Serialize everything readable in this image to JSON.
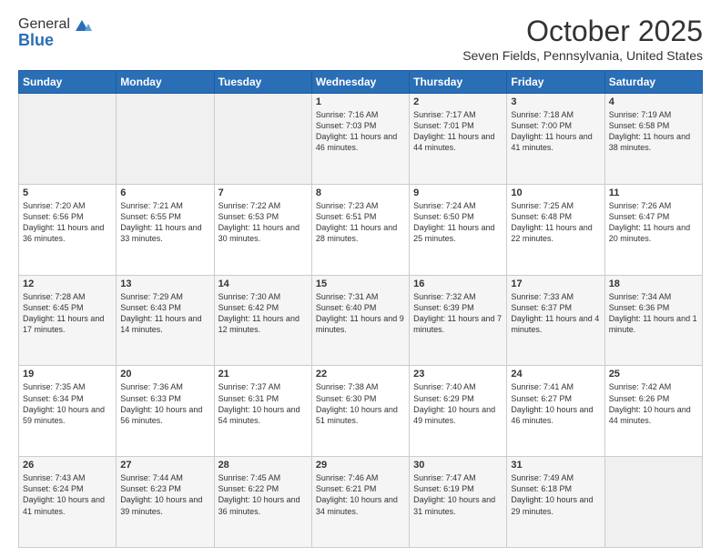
{
  "logo": {
    "general": "General",
    "blue": "Blue"
  },
  "header": {
    "title": "October 2025",
    "subtitle": "Seven Fields, Pennsylvania, United States"
  },
  "weekdays": [
    "Sunday",
    "Monday",
    "Tuesday",
    "Wednesday",
    "Thursday",
    "Friday",
    "Saturday"
  ],
  "weeks": [
    [
      {
        "day": "",
        "content": ""
      },
      {
        "day": "",
        "content": ""
      },
      {
        "day": "",
        "content": ""
      },
      {
        "day": "1",
        "content": "Sunrise: 7:16 AM\nSunset: 7:03 PM\nDaylight: 11 hours and 46 minutes."
      },
      {
        "day": "2",
        "content": "Sunrise: 7:17 AM\nSunset: 7:01 PM\nDaylight: 11 hours and 44 minutes."
      },
      {
        "day": "3",
        "content": "Sunrise: 7:18 AM\nSunset: 7:00 PM\nDaylight: 11 hours and 41 minutes."
      },
      {
        "day": "4",
        "content": "Sunrise: 7:19 AM\nSunset: 6:58 PM\nDaylight: 11 hours and 38 minutes."
      }
    ],
    [
      {
        "day": "5",
        "content": "Sunrise: 7:20 AM\nSunset: 6:56 PM\nDaylight: 11 hours and 36 minutes."
      },
      {
        "day": "6",
        "content": "Sunrise: 7:21 AM\nSunset: 6:55 PM\nDaylight: 11 hours and 33 minutes."
      },
      {
        "day": "7",
        "content": "Sunrise: 7:22 AM\nSunset: 6:53 PM\nDaylight: 11 hours and 30 minutes."
      },
      {
        "day": "8",
        "content": "Sunrise: 7:23 AM\nSunset: 6:51 PM\nDaylight: 11 hours and 28 minutes."
      },
      {
        "day": "9",
        "content": "Sunrise: 7:24 AM\nSunset: 6:50 PM\nDaylight: 11 hours and 25 minutes."
      },
      {
        "day": "10",
        "content": "Sunrise: 7:25 AM\nSunset: 6:48 PM\nDaylight: 11 hours and 22 minutes."
      },
      {
        "day": "11",
        "content": "Sunrise: 7:26 AM\nSunset: 6:47 PM\nDaylight: 11 hours and 20 minutes."
      }
    ],
    [
      {
        "day": "12",
        "content": "Sunrise: 7:28 AM\nSunset: 6:45 PM\nDaylight: 11 hours and 17 minutes."
      },
      {
        "day": "13",
        "content": "Sunrise: 7:29 AM\nSunset: 6:43 PM\nDaylight: 11 hours and 14 minutes."
      },
      {
        "day": "14",
        "content": "Sunrise: 7:30 AM\nSunset: 6:42 PM\nDaylight: 11 hours and 12 minutes."
      },
      {
        "day": "15",
        "content": "Sunrise: 7:31 AM\nSunset: 6:40 PM\nDaylight: 11 hours and 9 minutes."
      },
      {
        "day": "16",
        "content": "Sunrise: 7:32 AM\nSunset: 6:39 PM\nDaylight: 11 hours and 7 minutes."
      },
      {
        "day": "17",
        "content": "Sunrise: 7:33 AM\nSunset: 6:37 PM\nDaylight: 11 hours and 4 minutes."
      },
      {
        "day": "18",
        "content": "Sunrise: 7:34 AM\nSunset: 6:36 PM\nDaylight: 11 hours and 1 minute."
      }
    ],
    [
      {
        "day": "19",
        "content": "Sunrise: 7:35 AM\nSunset: 6:34 PM\nDaylight: 10 hours and 59 minutes."
      },
      {
        "day": "20",
        "content": "Sunrise: 7:36 AM\nSunset: 6:33 PM\nDaylight: 10 hours and 56 minutes."
      },
      {
        "day": "21",
        "content": "Sunrise: 7:37 AM\nSunset: 6:31 PM\nDaylight: 10 hours and 54 minutes."
      },
      {
        "day": "22",
        "content": "Sunrise: 7:38 AM\nSunset: 6:30 PM\nDaylight: 10 hours and 51 minutes."
      },
      {
        "day": "23",
        "content": "Sunrise: 7:40 AM\nSunset: 6:29 PM\nDaylight: 10 hours and 49 minutes."
      },
      {
        "day": "24",
        "content": "Sunrise: 7:41 AM\nSunset: 6:27 PM\nDaylight: 10 hours and 46 minutes."
      },
      {
        "day": "25",
        "content": "Sunrise: 7:42 AM\nSunset: 6:26 PM\nDaylight: 10 hours and 44 minutes."
      }
    ],
    [
      {
        "day": "26",
        "content": "Sunrise: 7:43 AM\nSunset: 6:24 PM\nDaylight: 10 hours and 41 minutes."
      },
      {
        "day": "27",
        "content": "Sunrise: 7:44 AM\nSunset: 6:23 PM\nDaylight: 10 hours and 39 minutes."
      },
      {
        "day": "28",
        "content": "Sunrise: 7:45 AM\nSunset: 6:22 PM\nDaylight: 10 hours and 36 minutes."
      },
      {
        "day": "29",
        "content": "Sunrise: 7:46 AM\nSunset: 6:21 PM\nDaylight: 10 hours and 34 minutes."
      },
      {
        "day": "30",
        "content": "Sunrise: 7:47 AM\nSunset: 6:19 PM\nDaylight: 10 hours and 31 minutes."
      },
      {
        "day": "31",
        "content": "Sunrise: 7:49 AM\nSunset: 6:18 PM\nDaylight: 10 hours and 29 minutes."
      },
      {
        "day": "",
        "content": ""
      }
    ]
  ]
}
